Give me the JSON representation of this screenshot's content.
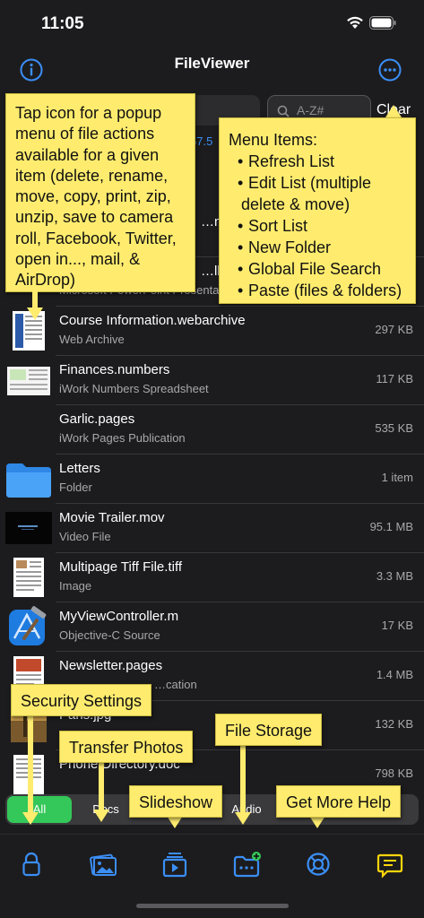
{
  "status_bar": {
    "time": "11:05"
  },
  "nav": {
    "title": "FileViewer"
  },
  "search": {
    "sort_text": "A-Z#",
    "clear_label": "Clear",
    "path_fragment": "67.5"
  },
  "files": [
    {
      "name": "…m4a",
      "kind": "",
      "size": "",
      "thumb": "none"
    },
    {
      "name": "…lbum",
      "kind": "Microsoft PowerPoint Presentation",
      "size": "",
      "thumb": "none"
    },
    {
      "name": "Course Information.webarchive",
      "kind": "Web Archive",
      "size": "297 KB",
      "thumb": "doc-blue"
    },
    {
      "name": "Finances.numbers",
      "kind": "iWork Numbers Spreadsheet",
      "size": "117 KB",
      "thumb": "sheet"
    },
    {
      "name": "Garlic.pages",
      "kind": "iWork Pages Publication",
      "size": "535 KB",
      "thumb": "none"
    },
    {
      "name": "Letters",
      "kind": "Folder",
      "size": "1 item",
      "thumb": "folder"
    },
    {
      "name": "Movie Trailer.mov",
      "kind": "Video File",
      "size": "95.1 MB",
      "thumb": "video"
    },
    {
      "name": "Multipage Tiff File.tiff",
      "kind": "Image",
      "size": "3.3 MB",
      "thumb": "doc-white"
    },
    {
      "name": "MyViewController.m",
      "kind": "Objective-C Source",
      "size": "17 KB",
      "thumb": "xcode"
    },
    {
      "name": "Newsletter.pages",
      "kind": "…cation",
      "size": "1.4 MB",
      "thumb": "newsletter"
    },
    {
      "name": "Paris.jpg",
      "kind": "",
      "size": "132 KB",
      "thumb": "photo"
    },
    {
      "name": "Phone Directory.doc",
      "kind": "",
      "size": "798 KB",
      "thumb": "doc-white"
    }
  ],
  "filter_segments": {
    "all": "All",
    "docs": "Docs",
    "audio": "Audio"
  },
  "callouts": {
    "file_actions": "Tap icon for a popup menu of file actions available for a given item (delete, rename, move, copy, print, zip, unzip, save to camera roll, Facebook, Twitter, open in..., mail, & AirDrop)",
    "menu_title": "Menu Items:",
    "menu_items": [
      "Refresh List",
      "Edit List (multiple",
      "delete & move)",
      "Sort List",
      "New Folder",
      "Global File Search",
      "Paste (files & folders)"
    ],
    "security": "Security Settings",
    "transfer": "Transfer Photos",
    "slideshow": "Slideshow",
    "storage": "File Storage",
    "help": "Get More Help"
  },
  "tabs": [
    {
      "icon": "lock-icon"
    },
    {
      "icon": "photos-icon"
    },
    {
      "icon": "slideshow-icon"
    },
    {
      "icon": "file-storage-icon"
    },
    {
      "icon": "help-icon"
    },
    {
      "icon": "message-icon"
    }
  ],
  "colors": {
    "accent": "#3b8ef5",
    "callout": "#ffec6e",
    "active_segment": "#34c759",
    "message_tab": "#ffd60a"
  }
}
